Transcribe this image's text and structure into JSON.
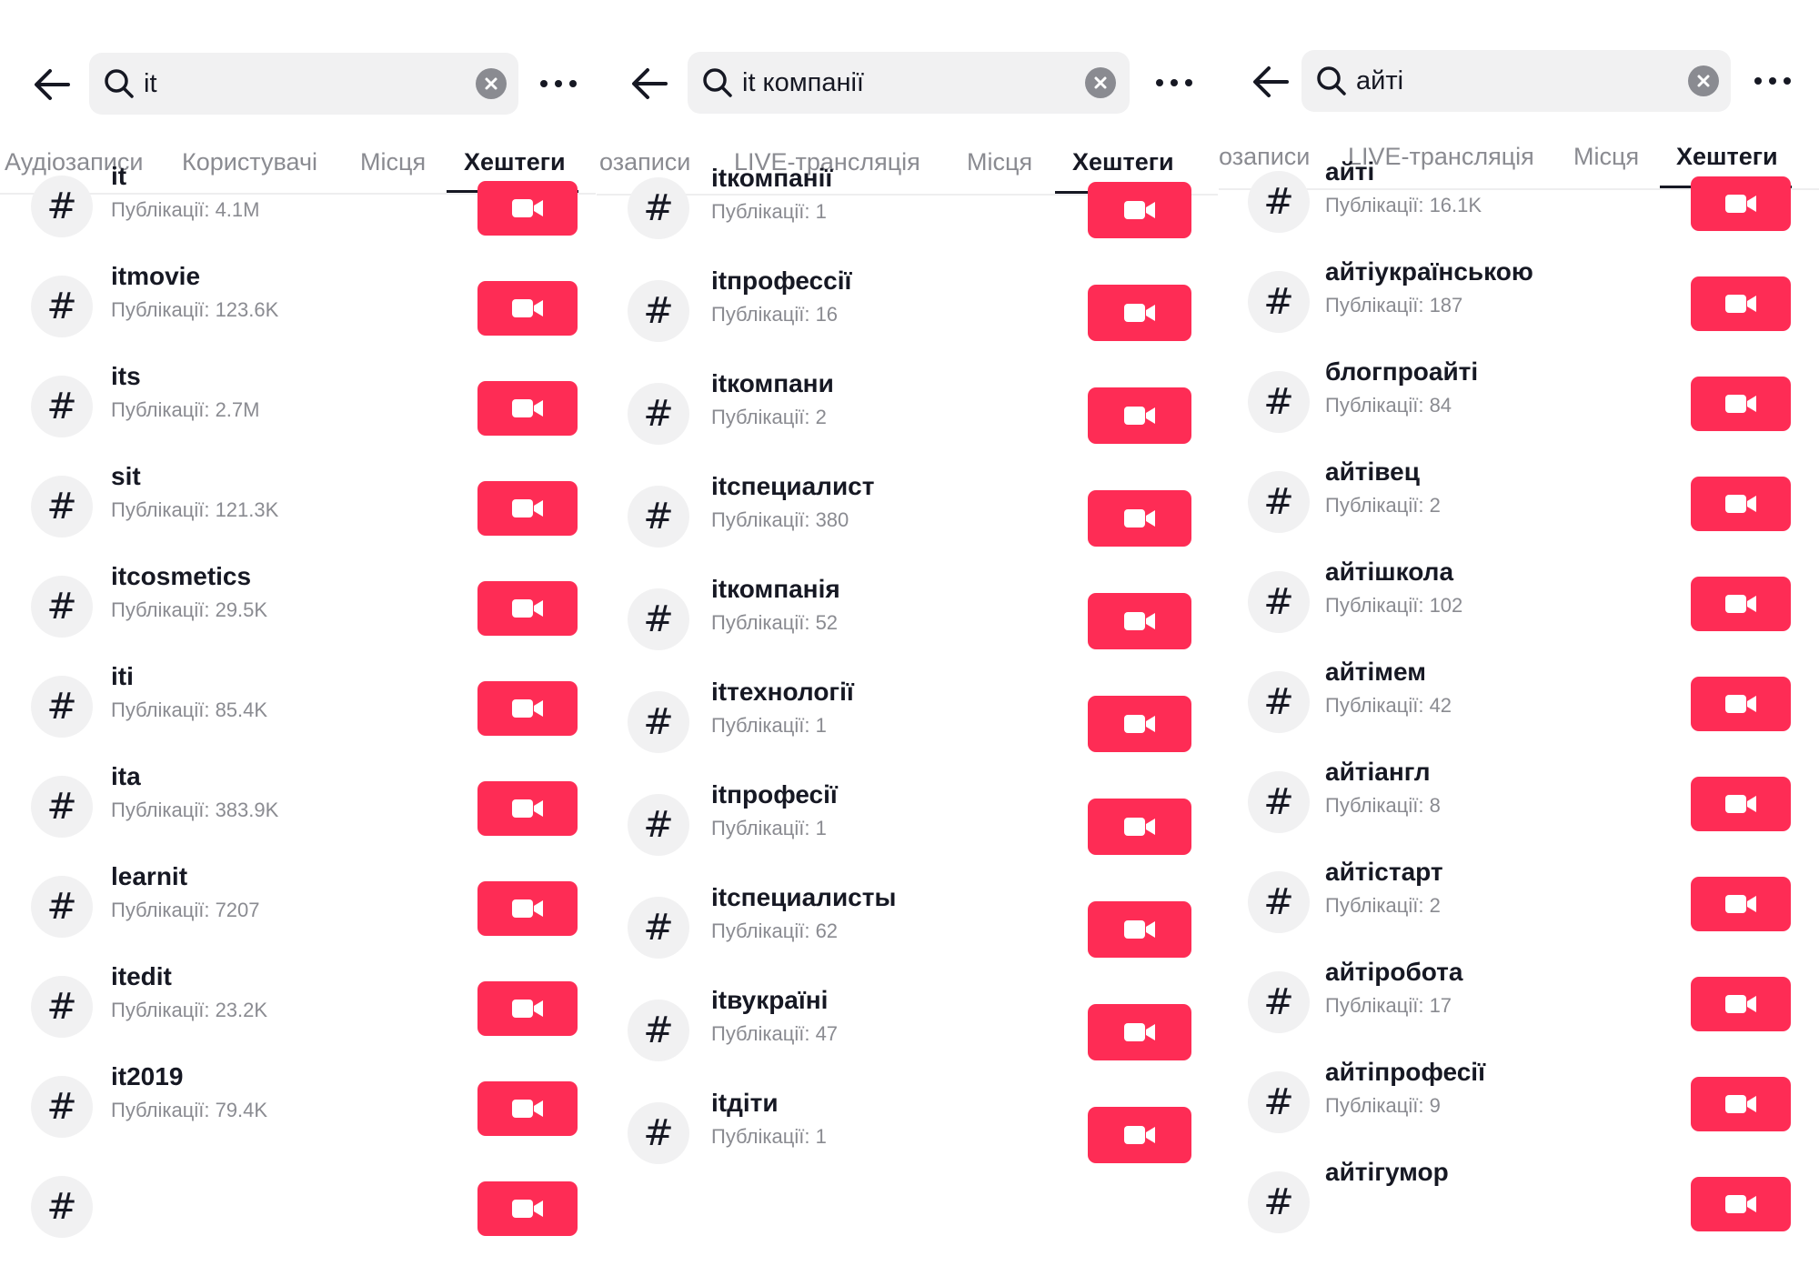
{
  "colors": {
    "accent": "#fe2c55",
    "text": "#161823",
    "muted": "#8a8b91",
    "surface": "#f1f1f2"
  },
  "icons": {
    "back": "arrow-left-icon",
    "search": "search-icon",
    "clear": "clear-x-icon",
    "more": "more-dots-icon",
    "hashtag": "hashtag-icon",
    "record": "video-camera-icon"
  },
  "panels": [
    {
      "query": "it",
      "tabs": [
        "Аудіозаписи",
        "Користувачі",
        "Місця",
        "Хештеги"
      ],
      "active_tab": 3,
      "items": [
        {
          "name": "it",
          "count": "Публікації: 4.1M"
        },
        {
          "name": "itmovie",
          "count": "Публікації: 123.6K"
        },
        {
          "name": "its",
          "count": "Публікації: 2.7M"
        },
        {
          "name": "sit",
          "count": "Публікації: 121.3K"
        },
        {
          "name": "itcosmetics",
          "count": "Публікації: 29.5K"
        },
        {
          "name": "iti",
          "count": "Публікації: 85.4K"
        },
        {
          "name": "ita",
          "count": "Публікації: 383.9K"
        },
        {
          "name": "learnit",
          "count": "Публікації: 7207"
        },
        {
          "name": "itedit",
          "count": "Публікації: 23.2K"
        },
        {
          "name": "it2019",
          "count": "Публікації: 79.4K"
        },
        {
          "name": "",
          "count": ""
        }
      ]
    },
    {
      "query": "it компанії",
      "tabs": [
        "озаписи",
        "LIVE-трансляція",
        "Місця",
        "Хештеги"
      ],
      "active_tab": 3,
      "items": [
        {
          "name": "itкомпанії",
          "count": "Публікації: 1"
        },
        {
          "name": "itпрофессії",
          "count": "Публікації: 16"
        },
        {
          "name": "itкомпани",
          "count": "Публікації: 2"
        },
        {
          "name": "itспециалист",
          "count": "Публікації: 380"
        },
        {
          "name": "itкомпанія",
          "count": "Публікації: 52"
        },
        {
          "name": "itтехнології",
          "count": "Публікації: 1"
        },
        {
          "name": "itпрофесії",
          "count": "Публікації: 1"
        },
        {
          "name": "itспециалисты",
          "count": "Публікації: 62"
        },
        {
          "name": "itвукраїні",
          "count": "Публікації: 47"
        },
        {
          "name": "itдіти",
          "count": "Публікації: 1"
        }
      ]
    },
    {
      "query": "айті",
      "tabs": [
        "озаписи",
        "LIVE-трансляція",
        "Місця",
        "Хештеги"
      ],
      "active_tab": 3,
      "items": [
        {
          "name": "айті",
          "count": "Публікації: 16.1K"
        },
        {
          "name": "айтіукраїнською",
          "count": "Публікації: 187"
        },
        {
          "name": "блогпроайті",
          "count": "Публікації: 84"
        },
        {
          "name": "айтівец",
          "count": "Публікації: 2"
        },
        {
          "name": "айтішкола",
          "count": "Публікації: 102"
        },
        {
          "name": "айтімем",
          "count": "Публікації: 42"
        },
        {
          "name": "айтіангл",
          "count": "Публікації: 8"
        },
        {
          "name": "айтістарт",
          "count": "Публікації: 2"
        },
        {
          "name": "айтіробота",
          "count": "Публікації: 17"
        },
        {
          "name": "айтіпрофесії",
          "count": "Публікації: 9"
        },
        {
          "name": "айтігумор",
          "count": ""
        }
      ]
    }
  ]
}
